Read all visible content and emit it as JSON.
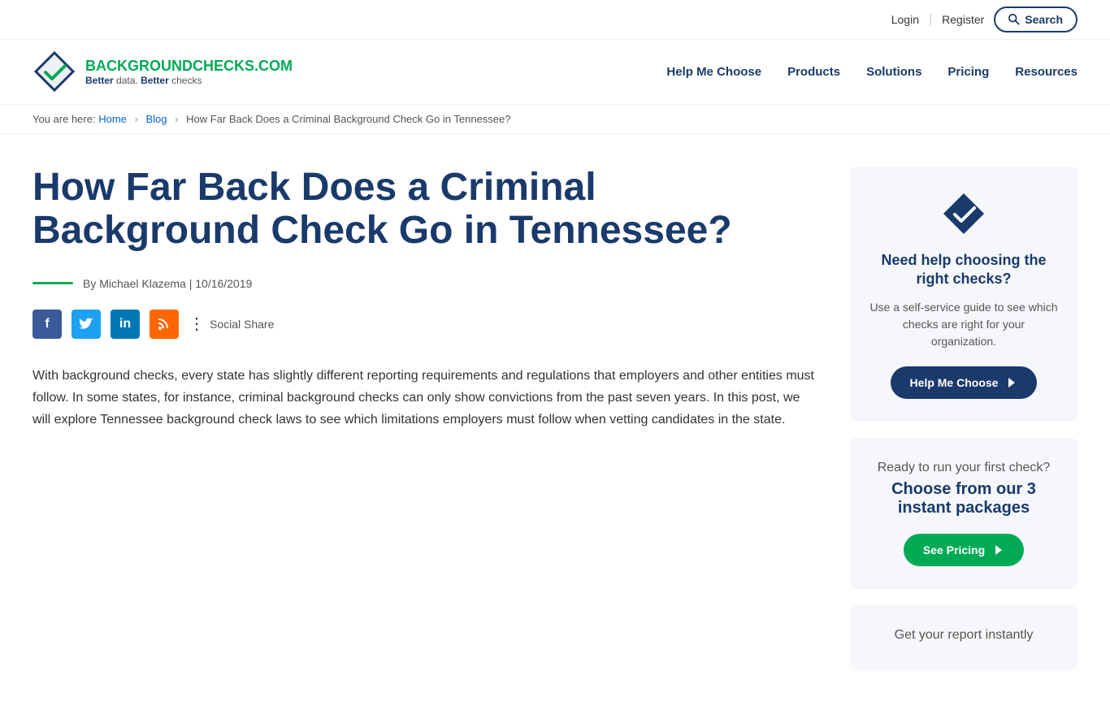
{
  "topbar": {
    "login": "Login",
    "register": "Register",
    "search": "Search"
  },
  "nav": {
    "logo_main": "BACKGROUND",
    "logo_accent": "CHECKS.COM",
    "tagline_better": "Better",
    "tagline_data": "data.",
    "tagline_better2": "Better",
    "tagline_checks": "checks",
    "links": [
      {
        "label": "Help Me Choose",
        "id": "help-me-choose"
      },
      {
        "label": "Products",
        "id": "products"
      },
      {
        "label": "Solutions",
        "id": "solutions"
      },
      {
        "label": "Pricing",
        "id": "pricing"
      },
      {
        "label": "Resources",
        "id": "resources"
      }
    ]
  },
  "breadcrumb": {
    "you_are_here": "You are here:",
    "home": "Home",
    "blog": "Blog",
    "current": "How Far Back Does a Criminal Background Check Go in Tennessee?"
  },
  "article": {
    "title": "How Far Back Does a Criminal Background Check Go in Tennessee?",
    "author_prefix": "By",
    "author": "Michael Klazema",
    "date": "10/16/2019",
    "body": "With background checks, every state has slightly different reporting requirements and regulations that employers and other entities must follow. In some states, for instance, criminal background checks can only show convictions from the past seven years. In this post, we will explore Tennessee background check laws to see which limitations employers must follow when vetting candidates in the state."
  },
  "social": {
    "share_label": "Social Share"
  },
  "sidebar": {
    "card1": {
      "title": "Need help choosing the right checks?",
      "desc": "Use a self-service guide to see which checks are right for your organization.",
      "btn": "Help Me Choose"
    },
    "card2": {
      "title": "Ready to run your first check?",
      "packages": "Choose from our 3 instant packages",
      "btn": "See Pricing"
    },
    "card3": {
      "title": "Get your report instantly"
    }
  }
}
